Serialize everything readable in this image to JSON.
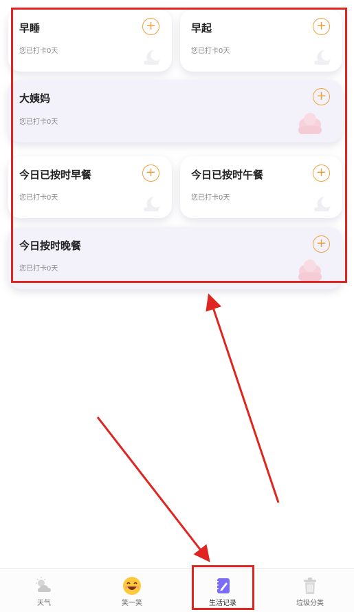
{
  "cards": [
    {
      "title": "早睡",
      "subtitle": "您已打卡0天",
      "plus": "+"
    },
    {
      "title": "早起",
      "subtitle": "您已打卡0天",
      "plus": "+"
    },
    {
      "title": "大姨妈",
      "subtitle": "您已打卡0天",
      "plus": "+"
    },
    {
      "title": "今日已按时早餐",
      "subtitle": "您已打卡0天",
      "plus": "+"
    },
    {
      "title": "今日已按时午餐",
      "subtitle": "您已打卡0天",
      "plus": "+"
    },
    {
      "title": "今日按时晚餐",
      "subtitle": "您已打卡0天",
      "plus": "+"
    }
  ],
  "tabbar": {
    "tabs": [
      {
        "label": "天气",
        "icon": "weather-icon"
      },
      {
        "label": "笑一笑",
        "icon": "smile-icon"
      },
      {
        "label": "生活记录",
        "icon": "notebook-pencil-icon",
        "active": true
      },
      {
        "label": "垃圾分类",
        "icon": "trash-icon"
      }
    ]
  },
  "colors": {
    "accent_orange": "#f0a040",
    "annotation_red": "#e0241f",
    "active_tab_purple": "#7b6cf6",
    "wide_card_bg": "#f3f2fb"
  }
}
